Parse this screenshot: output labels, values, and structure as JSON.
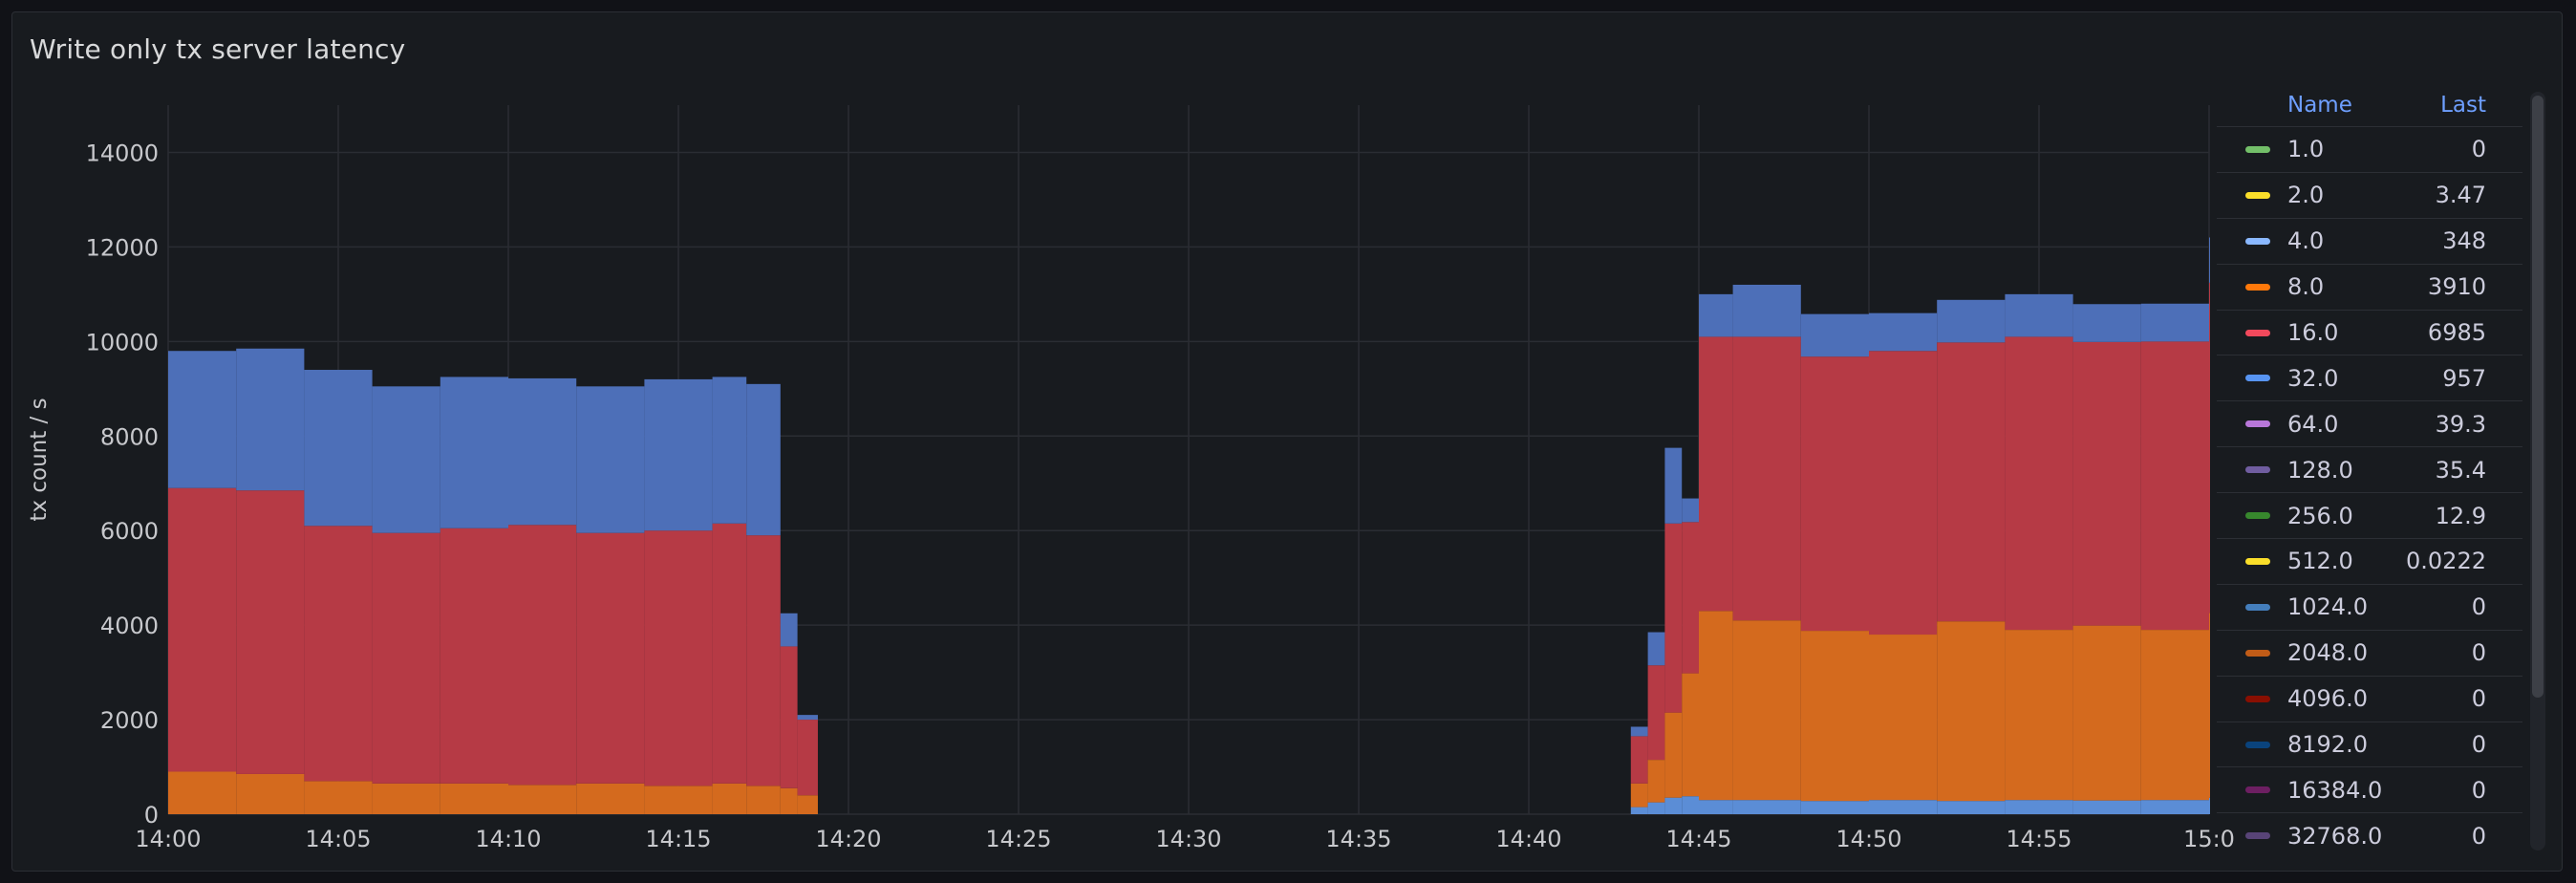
{
  "panel": {
    "title": "Write only tx server latency"
  },
  "legend": {
    "name_header": "Name",
    "last_header": "Last",
    "items": [
      {
        "name": "1.0",
        "last": "0",
        "color": "#73bf69"
      },
      {
        "name": "2.0",
        "last": "3.47",
        "color": "#fade2a"
      },
      {
        "name": "4.0",
        "last": "348",
        "color": "#8ab8ff"
      },
      {
        "name": "8.0",
        "last": "3910",
        "color": "#ff780a"
      },
      {
        "name": "16.0",
        "last": "6985",
        "color": "#f2495c"
      },
      {
        "name": "32.0",
        "last": "957",
        "color": "#5794f2"
      },
      {
        "name": "64.0",
        "last": "39.3",
        "color": "#b877d9"
      },
      {
        "name": "128.0",
        "last": "35.4",
        "color": "#705da0"
      },
      {
        "name": "256.0",
        "last": "12.9",
        "color": "#37872d"
      },
      {
        "name": "512.0",
        "last": "0.0222",
        "color": "#fade2a"
      },
      {
        "name": "1024.0",
        "last": "0",
        "color": "#447ebc"
      },
      {
        "name": "2048.0",
        "last": "0",
        "color": "#c15c17"
      },
      {
        "name": "4096.0",
        "last": "0",
        "color": "#890f02"
      },
      {
        "name": "8192.0",
        "last": "0",
        "color": "#0a437c"
      },
      {
        "name": "16384.0",
        "last": "0",
        "color": "#6d1f62"
      },
      {
        "name": "32768.0",
        "last": "0",
        "color": "#584477"
      }
    ]
  },
  "chart_data": {
    "type": "bar",
    "stacked": true,
    "ylabel": "tx count / s",
    "ylim": [
      0,
      15000
    ],
    "yticks": [
      0,
      2000,
      4000,
      6000,
      8000,
      10000,
      12000,
      14000
    ],
    "ytick_labels": [
      "0",
      "2000",
      "4000",
      "6000",
      "8000",
      "10000",
      "12000",
      "14000"
    ],
    "xlim": [
      "14:00",
      "15:00"
    ],
    "xtick_labels": [
      "14:00",
      "14:05",
      "14:10",
      "14:15",
      "14:20",
      "14:25",
      "14:30",
      "14:35",
      "14:40",
      "14:45",
      "14:50",
      "14:55",
      "15:0"
    ],
    "grid": true,
    "legend_position": "right",
    "series_colors": {
      "4.0": "#5b8dd6",
      "8.0": "#d46a1e",
      "16.0": "#b63a45",
      "32.0": "#4d6fb8"
    },
    "x": [
      "14:00",
      "14:02",
      "14:04",
      "14:06",
      "14:08",
      "14:10",
      "14:12",
      "14:14",
      "14:16",
      "14:17",
      "14:18",
      "14:18:30",
      "14:43",
      "14:43:30",
      "14:44",
      "14:44:30",
      "14:45",
      "14:46",
      "14:48",
      "14:50",
      "14:52",
      "14:54",
      "14:56",
      "14:58",
      "15:00"
    ],
    "series": [
      {
        "name": "4.0",
        "values": [
          0,
          0,
          0,
          0,
          0,
          0,
          0,
          0,
          0,
          0,
          0,
          0,
          150,
          250,
          350,
          380,
          300,
          300,
          280,
          300,
          280,
          300,
          290,
          300,
          348
        ]
      },
      {
        "name": "8.0",
        "values": [
          900,
          850,
          700,
          650,
          650,
          620,
          650,
          600,
          650,
          600,
          550,
          400,
          500,
          900,
          1800,
          2600,
          4000,
          3800,
          3600,
          3500,
          3800,
          3600,
          3700,
          3600,
          3910
        ]
      },
      {
        "name": "16.0",
        "values": [
          6000,
          6000,
          5400,
          5300,
          5400,
          5500,
          5300,
          5400,
          5500,
          5300,
          3000,
          1600,
          1000,
          2000,
          4000,
          3200,
          5800,
          6000,
          5800,
          6000,
          5900,
          6200,
          6000,
          6100,
          6985
        ]
      },
      {
        "name": "32.0",
        "values": [
          2900,
          3000,
          3300,
          3100,
          3200,
          3100,
          3100,
          3200,
          3100,
          3200,
          700,
          100,
          200,
          700,
          1600,
          500,
          900,
          1100,
          900,
          800,
          900,
          900,
          800,
          800,
          957
        ]
      }
    ]
  }
}
